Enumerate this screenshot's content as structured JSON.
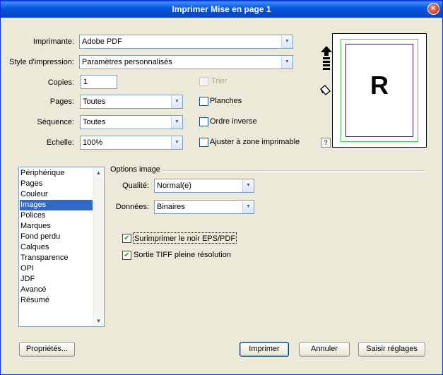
{
  "window": {
    "title": "Imprimer Mise en page 1",
    "close_glyph": "✕"
  },
  "fields": {
    "printer_label": "Imprimante:",
    "printer_value": "Adobe PDF",
    "style_label": "Style d'impression:",
    "style_value": "Paramètres personnalisés",
    "copies_label": "Copies:",
    "copies_value": "1",
    "pages_label": "Pages:",
    "pages_value": "Toutes",
    "sequence_label": "Séquence:",
    "sequence_value": "Toutes",
    "scale_label": "Echelle:",
    "scale_value": "100%"
  },
  "checkboxes": {
    "sort": {
      "label": "Trier",
      "checked": false,
      "disabled": true
    },
    "spreads": {
      "label": "Planches",
      "checked": false
    },
    "reverse": {
      "label": "Ordre inverse",
      "checked": false
    },
    "fit": {
      "label": "Ajuster à zone imprimable",
      "checked": false
    }
  },
  "preview": {
    "letter": "R",
    "help": "?"
  },
  "categories": {
    "items": [
      "Périphérique",
      "Pages",
      "Couleur",
      "Images",
      "Polices",
      "Marques",
      "Fond perdu",
      "Calques",
      "Transparence",
      "OPI",
      "JDF",
      "Avancé",
      "Résumé"
    ],
    "selected": "Images"
  },
  "image_options": {
    "group_title": "Options image",
    "quality_label": "Qualité:",
    "quality_value": "Normal(e)",
    "data_label": "Données:",
    "data_value": "Binaires",
    "overprint_label": "Surimprimer le noir EPS/PDF",
    "overprint_checked": true,
    "tiff_label": "Sortie TIFF pleine résolution",
    "tiff_checked": true
  },
  "buttons": {
    "properties": "Propriétés...",
    "print": "Imprimer",
    "cancel": "Annuler",
    "save_settings": "Saisir réglages"
  },
  "colors": {
    "title_bar": "#0855dd",
    "selection": "#316ac5",
    "preview_margin": "#3ec83e",
    "preview_page": "#1a1a8c"
  }
}
